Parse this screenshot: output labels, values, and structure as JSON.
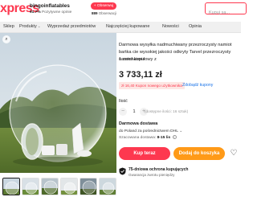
{
  "header": {
    "logo_text": "xpress",
    "store_name": "bingoinflatables",
    "store_rating": "91.7%",
    "store_rating_label": "Pozytywne opinie",
    "follow_label": "+ Obserwuj",
    "followers_count": "889",
    "followers_label": "Obserwacji",
    "search_placeholder": "Kupuj sa..."
  },
  "nav": {
    "items": [
      {
        "label": "Sklep"
      },
      {
        "label": "Produkty",
        "dropdown": true
      },
      {
        "label": "Wyprzedaż przedmiotów"
      },
      {
        "label": "Najczęściej kupowane"
      },
      {
        "label": "Nowości"
      },
      {
        "label": "Opinia"
      }
    ]
  },
  "product": {
    "title": "Darmowa wysyłka nadmuchiwany przezroczysty namiot bańka cie wysokiej jakości odkryty Tarvel przezroczysty namiot kopułowy z",
    "orders": "1 zamówienie",
    "price": "3 733,11 zł",
    "coupon_text": "zł 16,40 Kupon nowego użytkownika",
    "coupon_link": "Zdobądź kupony"
  },
  "quantity": {
    "label": "Ilość",
    "value": "1",
    "minus": "−",
    "plus": "+",
    "stock": "(dostępne ilości: 16 sztuk)"
  },
  "shipping": {
    "title": "Darmowa dostawa",
    "destination": "do Poland za pośrednictwem DHL",
    "date_label": "Szacowana dostawa:",
    "date_value": "8-15 lis"
  },
  "actions": {
    "buy_label": "Kup teraz",
    "cart_label": "Dodaj do koszyka",
    "wish_icon": "heart-icon"
  },
  "protection": {
    "title": "75-dniowa ochrona kupujących",
    "subtitle": "Gwarancja zwrotu pieniędzy"
  },
  "colors": {
    "brand_red": "#fd384f",
    "cart_orange": "#ff9a18",
    "link_blue": "#1a73e8"
  }
}
